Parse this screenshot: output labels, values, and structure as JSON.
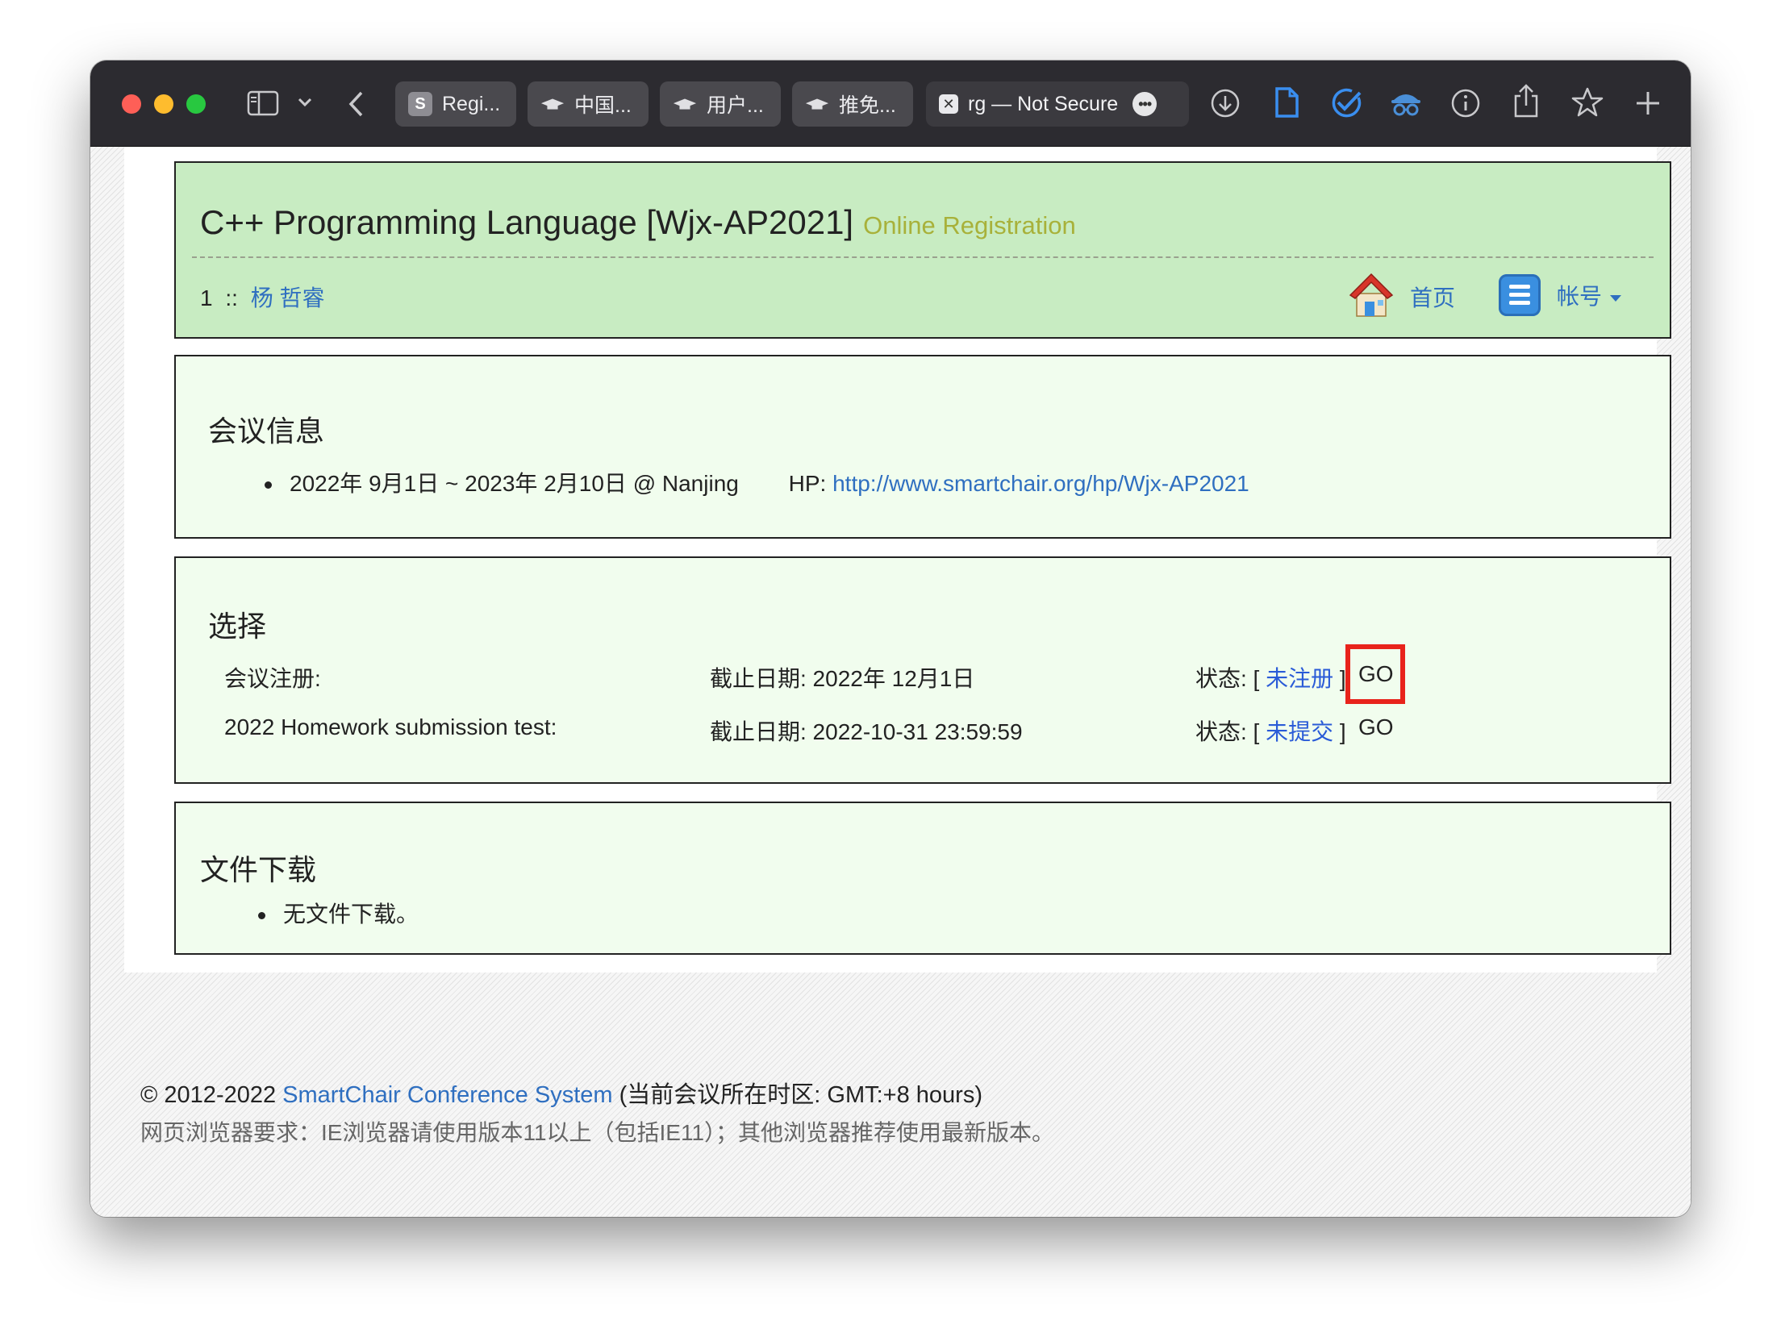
{
  "browser": {
    "tabs": [
      {
        "label": "Regi...",
        "favicon": "s-letter-favicon"
      },
      {
        "label": "中国...",
        "favicon": "mortarboard-favicon"
      },
      {
        "label": "用户...",
        "favicon": "mortarboard-favicon"
      },
      {
        "label": "推免...",
        "favicon": "mortarboard-favicon"
      }
    ],
    "active_tab": {
      "label": "rg — Not Secure",
      "more": "•••"
    }
  },
  "header": {
    "title": "C++ Programming Language [Wjx-AP2021]",
    "subtitle": "Online Registration",
    "user_id": "1",
    "separator": "::",
    "user_name": "杨 哲睿",
    "home_label": "首页",
    "account_label": "帐号"
  },
  "info": {
    "heading": "会议信息",
    "dates": "2022年 9月1日 ~ 2023年 2月10日 @ Nanjing",
    "hp_label": "HP:",
    "hp_url": "http://www.smartchair.org/hp/Wjx-AP2021"
  },
  "choices": {
    "heading": "选择",
    "rows": [
      {
        "name": "会议注册:",
        "deadline": "截止日期: 2022年 12月1日",
        "status_prefix": "状态: [",
        "status": "未注册",
        "status_suffix": "]",
        "go": "GO"
      },
      {
        "name": "2022 Homework submission test:",
        "deadline": "截止日期: 2022-10-31 23:59:59",
        "status_prefix": "状态: [",
        "status": "未提交",
        "status_suffix": "]",
        "go": "GO"
      }
    ]
  },
  "downloads": {
    "heading": "文件下载",
    "empty_text": "无文件下载。"
  },
  "footer": {
    "copyright": "© 2012-2022",
    "system_link": "SmartChair Conference System",
    "timezone": "(当前会议所在时区: GMT:+8 hours)",
    "browser_req": "网页浏览器要求：IE浏览器请使用版本11以上（包括IE11）；其他浏览器推荐使用最新版本。"
  },
  "colors": {
    "header_bg": "#c8ecc2",
    "panel_bg": "#f1fdee",
    "link": "#2f6fc0",
    "subtitle": "#a8b13a",
    "highlight": "#e8231b"
  }
}
